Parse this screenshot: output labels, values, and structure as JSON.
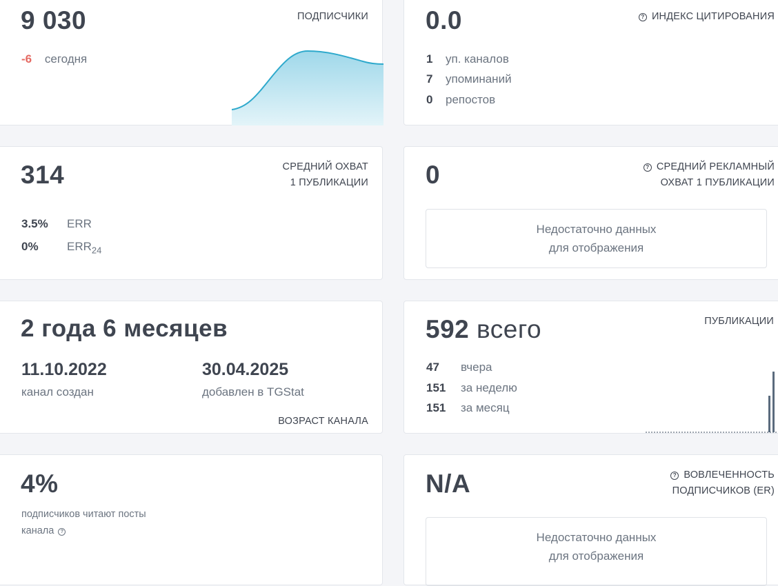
{
  "subscribers": {
    "value": "9 030",
    "label": "ПОДПИСЧИКИ",
    "delta": "-6",
    "delta_label": "сегодня"
  },
  "citation": {
    "value": "0.0",
    "label": "ИНДЕКС ЦИТИРОВАНИЯ",
    "rows": [
      {
        "n": "1",
        "t": "уп. каналов"
      },
      {
        "n": "7",
        "t": "упоминаний"
      },
      {
        "n": "0",
        "t": "репостов"
      }
    ]
  },
  "reach": {
    "value": "314",
    "label_line1": "СРЕДНИЙ ОХВАТ",
    "label_line2": "1 ПУБЛИКАЦИИ",
    "err_value": "3.5%",
    "err_label": "ERR",
    "err24_value": "0%",
    "err24_label": "ERR",
    "err24_sub": "24"
  },
  "ad_reach": {
    "value": "0",
    "label_line1": "СРЕДНИЙ РЕКЛАМНЫЙ",
    "label_line2": "ОХВАТ 1 ПУБЛИКАЦИИ",
    "nodata_line1": "Недостаточно данных",
    "nodata_line2": "для отображения"
  },
  "age": {
    "value": "2 года 6 месяцев",
    "created_date": "11.10.2022",
    "created_label": "канал создан",
    "added_date": "30.04.2025",
    "added_label": "добавлен в TGStat",
    "label": "ВОЗРАСТ КАНАЛА"
  },
  "publications": {
    "value": "592",
    "value_suffix": "всего",
    "label": "ПУБЛИКАЦИИ",
    "rows": [
      {
        "n": "47",
        "t": "вчера"
      },
      {
        "n": "151",
        "t": "за неделю"
      },
      {
        "n": "151",
        "t": "за месяц"
      }
    ]
  },
  "readers": {
    "value": "4%",
    "desc_line1": "подписчиков читают посты",
    "desc_line2": "канала"
  },
  "engagement": {
    "value": "N/A",
    "label_line1": "ВОВЛЕЧЕННОСТЬ",
    "label_line2": "ПОДПИСЧИКОВ (ER)",
    "nodata_line1": "Недостаточно данных",
    "nodata_line2": "для отображения"
  },
  "colors": {
    "accent_line": "#2ea9cc",
    "accent_fill": "#bfe6f1",
    "negative": "#e56a63",
    "bars": "#5a6b7d"
  },
  "icons": [
    "question-circle-icon"
  ]
}
